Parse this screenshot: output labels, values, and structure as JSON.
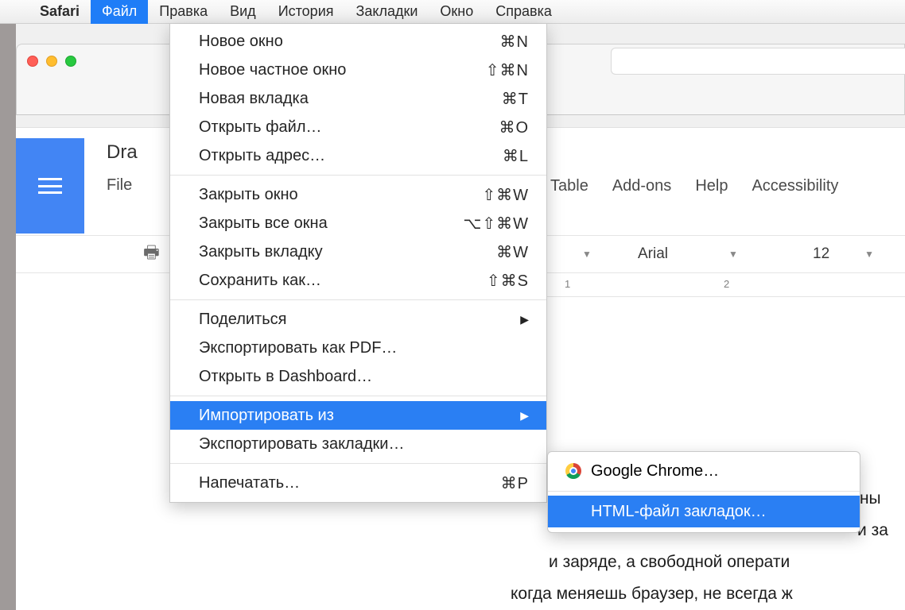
{
  "menubar": {
    "app": "Safari",
    "items": [
      "Файл",
      "Правка",
      "Вид",
      "История",
      "Закладки",
      "Окно",
      "Справка"
    ]
  },
  "dropdown_file": {
    "group1": [
      {
        "label": "Новое окно",
        "shortcut": "⌘N"
      },
      {
        "label": "Новое частное окно",
        "shortcut": "⇧⌘N"
      },
      {
        "label": "Новая вкладка",
        "shortcut": "⌘T"
      },
      {
        "label": "Открыть файл…",
        "shortcut": "⌘O"
      },
      {
        "label": "Открыть адрес…",
        "shortcut": "⌘L"
      }
    ],
    "group2": [
      {
        "label": "Закрыть окно",
        "shortcut": "⇧⌘W"
      },
      {
        "label": "Закрыть все окна",
        "shortcut": "⌥⇧⌘W"
      },
      {
        "label": "Закрыть вкладку",
        "shortcut": "⌘W"
      },
      {
        "label": "Сохранить как…",
        "shortcut": "⇧⌘S"
      }
    ],
    "group3": [
      {
        "label": "Поделиться",
        "submenu": true
      },
      {
        "label": "Экспортировать как PDF…"
      },
      {
        "label": "Открыть в Dashboard…"
      }
    ],
    "group4": [
      {
        "label": "Импортировать из",
        "submenu": true,
        "highlight": true
      },
      {
        "label": "Экспортировать закладки…"
      }
    ],
    "group5": [
      {
        "label": "Напечатать…",
        "shortcut": "⌘P"
      }
    ]
  },
  "submenu_import": {
    "items": [
      {
        "label": "Google Chrome…",
        "icon": "chrome"
      },
      {
        "label": "HTML-файл закладок…",
        "highlight": true
      }
    ]
  },
  "docs": {
    "title_fragment": "Dra",
    "menus": [
      "File",
      "Table",
      "Add-ons",
      "Help",
      "Accessibility"
    ],
    "font": "Arial",
    "font_size": "12",
    "ruler": [
      "1",
      "2"
    ],
    "body_lines": [
      "ьны",
      "и за",
      "и заряде, а свободной операти",
      "когда меняешь браузер, не всегда ж"
    ]
  }
}
